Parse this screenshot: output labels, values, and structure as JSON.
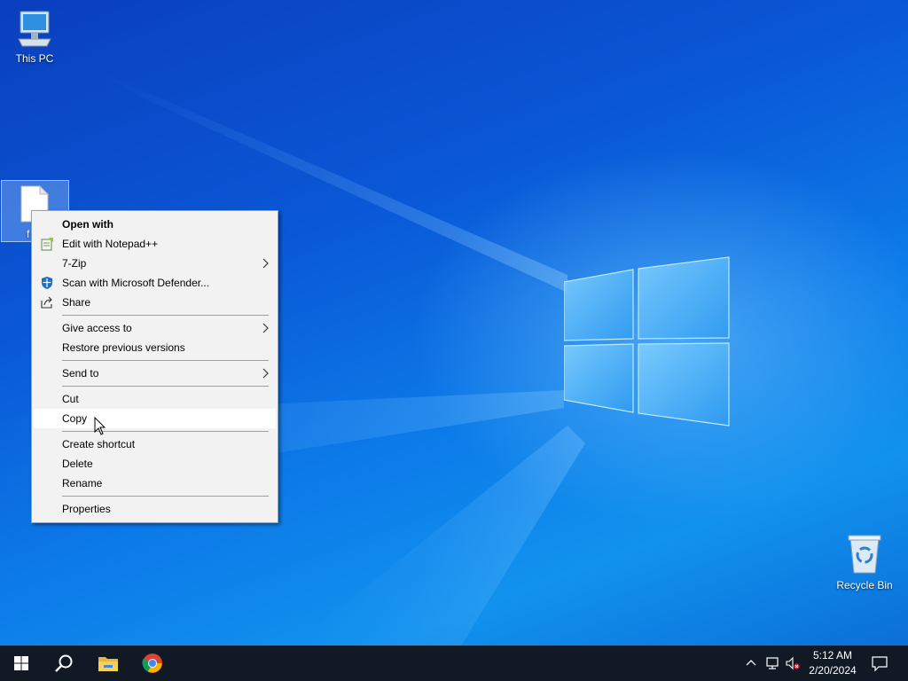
{
  "desktop": {
    "icons": {
      "this_pc": "This PC",
      "recycle_bin": "Recycle Bin",
      "selected_file": "f"
    }
  },
  "context_menu": {
    "items": [
      {
        "label": "Open with",
        "bold": true
      },
      {
        "label": "Edit with Notepad++",
        "icon": "notepadpp-icon"
      },
      {
        "label": "7-Zip",
        "submenu": true
      },
      {
        "label": "Scan with Microsoft Defender...",
        "icon": "defender-shield-icon"
      },
      {
        "label": "Share",
        "icon": "share-icon"
      },
      {
        "label": "Give access to",
        "submenu": true
      },
      {
        "label": "Restore previous versions"
      },
      {
        "label": "Send to",
        "submenu": true
      },
      {
        "label": "Cut"
      },
      {
        "label": "Copy",
        "hovered": true
      },
      {
        "label": "Create shortcut"
      },
      {
        "label": "Delete"
      },
      {
        "label": "Rename"
      },
      {
        "label": "Properties"
      }
    ]
  },
  "taskbar": {
    "pinned": [
      "windows-start-icon",
      "search-icon",
      "file-explorer-icon",
      "chrome-icon"
    ],
    "tray": [
      "chevron-up-icon",
      "network-icon",
      "volume-muted-icon"
    ],
    "clock": {
      "time": "5:12 AM",
      "date": "2/20/2024"
    },
    "notification_icon": "action-center-icon"
  },
  "colors": {
    "taskbar_bg": "#111a24",
    "menu_bg": "#f2f2f2",
    "menu_hover": "#ffffff",
    "wallpaper_primary": "#0a58d6"
  }
}
